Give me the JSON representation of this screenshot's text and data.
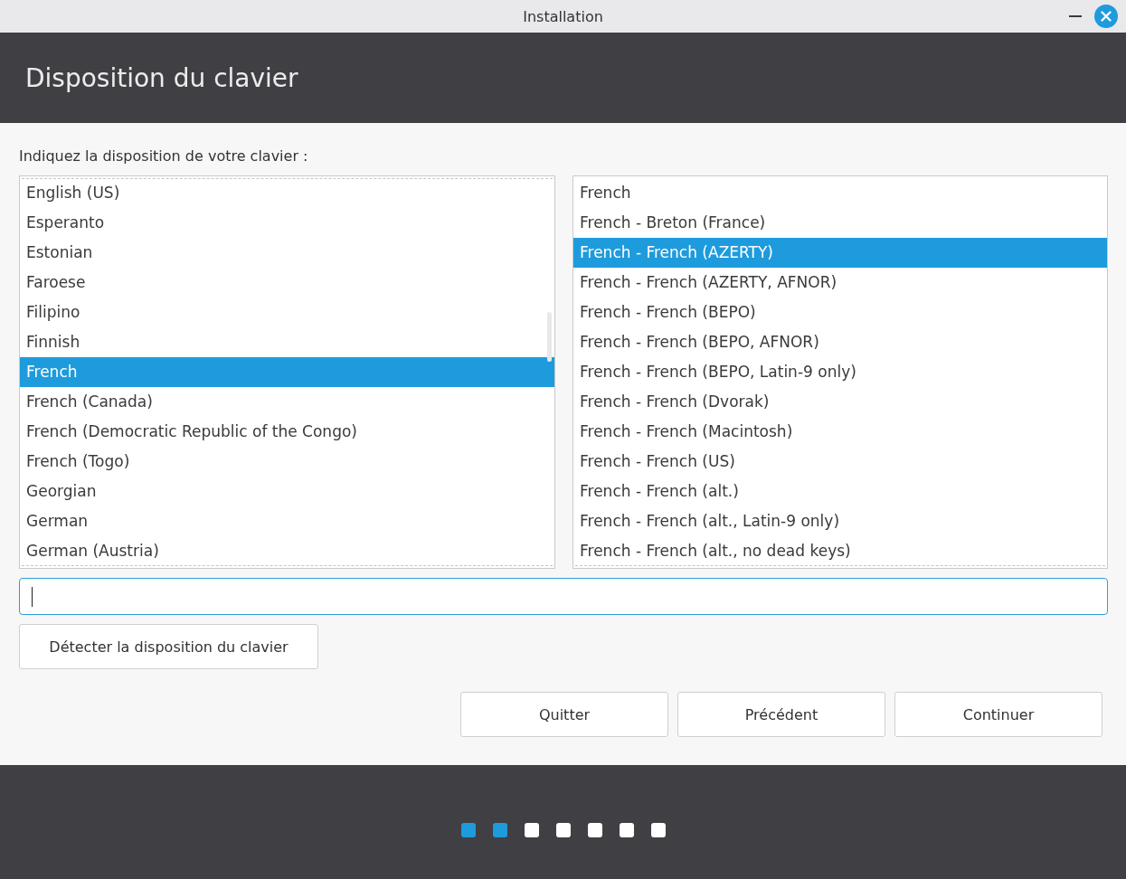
{
  "window": {
    "title": "Installation"
  },
  "header": {
    "title": "Disposition du clavier"
  },
  "prompt": "Indiquez la disposition de votre clavier :",
  "layouts": [
    {
      "label": "English (US)",
      "selected": false
    },
    {
      "label": "Esperanto",
      "selected": false
    },
    {
      "label": "Estonian",
      "selected": false
    },
    {
      "label": "Faroese",
      "selected": false
    },
    {
      "label": "Filipino",
      "selected": false
    },
    {
      "label": "Finnish",
      "selected": false
    },
    {
      "label": "French",
      "selected": true
    },
    {
      "label": "French (Canada)",
      "selected": false
    },
    {
      "label": "French (Democratic Republic of the Congo)",
      "selected": false
    },
    {
      "label": "French (Togo)",
      "selected": false
    },
    {
      "label": "Georgian",
      "selected": false
    },
    {
      "label": "German",
      "selected": false
    },
    {
      "label": "German (Austria)",
      "selected": false
    }
  ],
  "variants": [
    {
      "label": "French",
      "selected": false
    },
    {
      "label": "French - Breton (France)",
      "selected": false
    },
    {
      "label": "French - French (AZERTY)",
      "selected": true
    },
    {
      "label": "French - French (AZERTY, AFNOR)",
      "selected": false
    },
    {
      "label": "French - French (BEPO)",
      "selected": false
    },
    {
      "label": "French - French (BEPO, AFNOR)",
      "selected": false
    },
    {
      "label": "French - French (BEPO, Latin-9 only)",
      "selected": false
    },
    {
      "label": "French - French (Dvorak)",
      "selected": false
    },
    {
      "label": "French - French (Macintosh)",
      "selected": false
    },
    {
      "label": "French - French (US)",
      "selected": false
    },
    {
      "label": "French - French (alt.)",
      "selected": false
    },
    {
      "label": "French - French (alt., Latin-9 only)",
      "selected": false
    },
    {
      "label": "French - French (alt., no dead keys)",
      "selected": false
    }
  ],
  "search": {
    "focused": true
  },
  "detect_button": "Détecter la disposition du clavier",
  "buttons": [
    "Quitter",
    "Précédent",
    "Continuer"
  ],
  "progress": [
    {
      "completed": true
    },
    {
      "completed": true
    },
    {
      "completed": false
    },
    {
      "completed": false
    },
    {
      "completed": false
    },
    {
      "completed": false
    },
    {
      "completed": false
    }
  ]
}
